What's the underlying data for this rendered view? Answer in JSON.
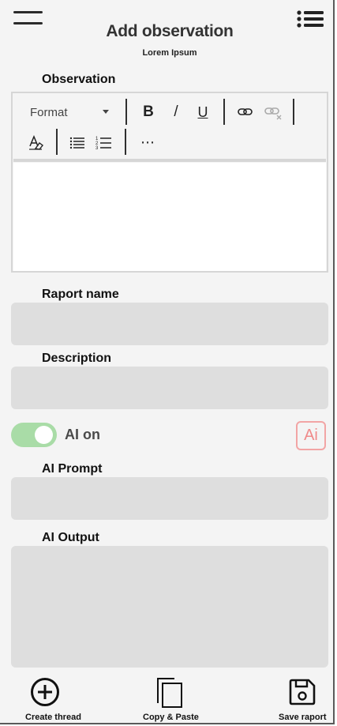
{
  "header": {
    "title": "Add observation",
    "subtitle": "Lorem Ipsum",
    "menu_icon": "hamburger-icon",
    "list_icon": "list-icon"
  },
  "observation": {
    "label": "Observation",
    "toolbar": {
      "format_label": "Format",
      "bold": "B",
      "italic": "/",
      "underline": "U",
      "more": "⋯"
    }
  },
  "raport_name": {
    "label": "Raport name",
    "value": ""
  },
  "description": {
    "label": "Description",
    "value": ""
  },
  "ai_toggle": {
    "label": "AI on",
    "state": "on",
    "color": "#a9dca7"
  },
  "ai_badge": {
    "text": "Ai",
    "color": "#f08a8a"
  },
  "ai_prompt": {
    "label": "AI Prompt",
    "value": ""
  },
  "ai_output": {
    "label": "AI Output",
    "value": ""
  },
  "bottom_bar": {
    "create_thread": "Create thread",
    "copy_paste": "Copy & Paste",
    "save_raport": "Save raport"
  }
}
